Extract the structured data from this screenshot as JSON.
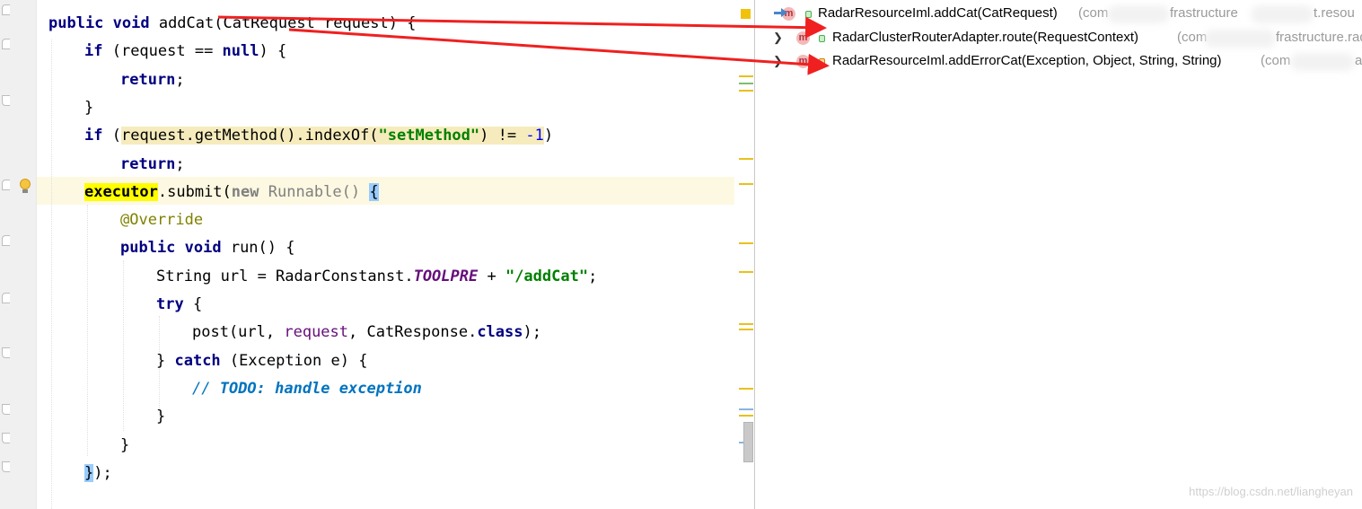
{
  "editor": {
    "lines": [
      {
        "id": "l1",
        "tokens": [
          {
            "t": "public void ",
            "c": "kw"
          },
          {
            "t": "addCat(CatRequest request) {",
            "c": ""
          }
        ]
      },
      {
        "id": "l2",
        "tokens": [
          {
            "t": "if ",
            "c": "kw"
          },
          {
            "t": "(request == ",
            "c": ""
          },
          {
            "t": "null",
            "c": "kw"
          },
          {
            "t": ") {",
            "c": ""
          }
        ]
      },
      {
        "id": "l3",
        "tokens": [
          {
            "t": "return",
            "c": "kw"
          },
          {
            "t": ";",
            "c": ""
          }
        ]
      },
      {
        "id": "l4",
        "tokens": [
          {
            "t": "}",
            "c": ""
          }
        ]
      },
      {
        "id": "l5",
        "tokens": [
          {
            "t": "if ",
            "c": "kw"
          },
          {
            "t": "(",
            "c": ""
          },
          {
            "t": "request.getMethod().indexOf(",
            "c": "warn-bg"
          },
          {
            "t": "\"setMethod\"",
            "c": "str warn-bg"
          },
          {
            "t": ") != ",
            "c": "warn-bg"
          },
          {
            "t": "-1",
            "c": "num warn-bg"
          },
          {
            "t": ")",
            "c": ""
          }
        ]
      },
      {
        "id": "l6",
        "tokens": [
          {
            "t": "return",
            "c": "kw"
          },
          {
            "t": ";",
            "c": ""
          }
        ]
      },
      {
        "id": "l7",
        "tokens": [
          {
            "t": "executor",
            "c": "sym-hl"
          },
          {
            "t": ".submit(",
            "c": ""
          },
          {
            "t": "new ",
            "c": "kw gray"
          },
          {
            "t": "Runnable() ",
            "c": "gray"
          },
          {
            "t": "{",
            "c": "brace-hl"
          }
        ]
      },
      {
        "id": "l8",
        "tokens": [
          {
            "t": "@Override",
            "c": "ann"
          }
        ]
      },
      {
        "id": "l9",
        "tokens": [
          {
            "t": "public void ",
            "c": "kw"
          },
          {
            "t": "run() {",
            "c": ""
          }
        ]
      },
      {
        "id": "l10",
        "tokens": [
          {
            "t": "String url = RadarConstanst.",
            "c": ""
          },
          {
            "t": "TOOLPRE",
            "c": "field"
          },
          {
            "t": " + ",
            "c": ""
          },
          {
            "t": "\"/addCat\"",
            "c": "str"
          },
          {
            "t": ";",
            "c": ""
          }
        ]
      },
      {
        "id": "l11",
        "tokens": [
          {
            "t": "try ",
            "c": "kw"
          },
          {
            "t": "{",
            "c": ""
          }
        ]
      },
      {
        "id": "l12",
        "tokens": [
          {
            "t": "post(url, ",
            "c": ""
          },
          {
            "t": "request",
            "c": "param"
          },
          {
            "t": ", CatResponse.",
            "c": ""
          },
          {
            "t": "class",
            "c": "kw"
          },
          {
            "t": ");",
            "c": ""
          }
        ]
      },
      {
        "id": "l13",
        "tokens": [
          {
            "t": "} ",
            "c": ""
          },
          {
            "t": "catch ",
            "c": "kw"
          },
          {
            "t": "(Exception e) {",
            "c": ""
          }
        ]
      },
      {
        "id": "l14",
        "tokens": [
          {
            "t": "// ",
            "c": "cmt"
          },
          {
            "t": "TODO: handle exception",
            "c": "cmt-bold"
          }
        ]
      },
      {
        "id": "l15",
        "tokens": [
          {
            "t": "}",
            "c": ""
          }
        ]
      },
      {
        "id": "l16",
        "tokens": [
          {
            "t": "}",
            "c": ""
          }
        ]
      },
      {
        "id": "l17",
        "tokens": [
          {
            "t": "}",
            "c": "brace-hl"
          },
          {
            "t": ");",
            "c": ""
          }
        ]
      }
    ]
  },
  "call_hierarchy": {
    "rows": [
      {
        "badge": "m",
        "method": "RadarResourceIml.addCat(CatRequest)",
        "pkg": "(com",
        "pkg2": "frastructure",
        "pkg3": "t.resou"
      },
      {
        "badge": "m",
        "method": "RadarClusterRouterAdapter.route(RequestContext)",
        "pkg": "(com",
        "pkg2": "frastructure.rad"
      },
      {
        "badge": "m",
        "method": "RadarResourceIml.addErrorCat(Exception, Object, String, String)",
        "pkg": "(com",
        "pkg2": "a"
      }
    ]
  },
  "watermark": "https://blog.csdn.net/liangheyan",
  "colors": {
    "arrow": "#f02020",
    "warn_marker": "#f0c20b",
    "keyword": "#000080",
    "string": "#008000"
  },
  "icons": [
    "bulb-icon",
    "method-icon",
    "lock-icon",
    "expand-arrow-icon",
    "navigate-arrow-icon",
    "fold-marker-icon"
  ]
}
